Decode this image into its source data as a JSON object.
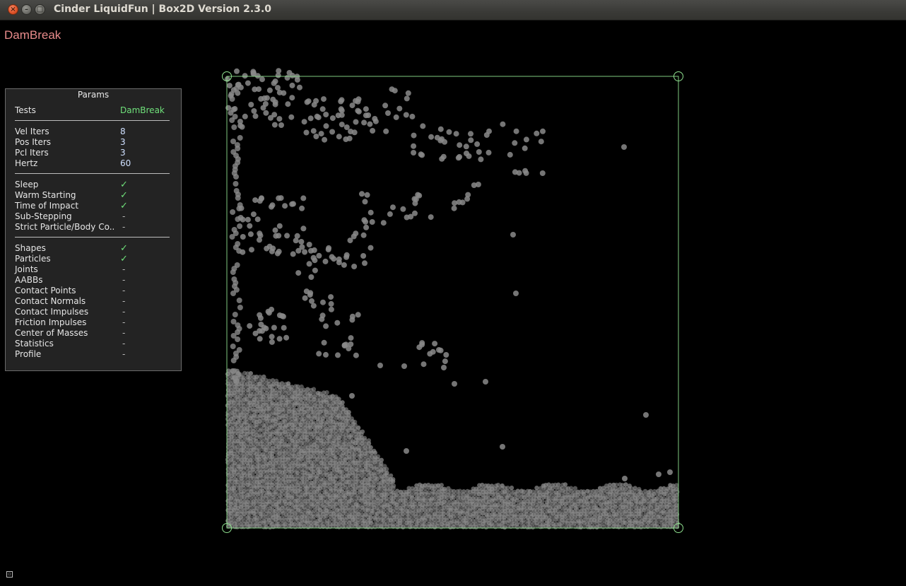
{
  "window": {
    "title": "Cinder LiquidFun | Box2D Version 2.3.0",
    "close_glyph": "×",
    "minimize_glyph": "–",
    "maximize_glyph": "□"
  },
  "scene": {
    "title": "DamBreak"
  },
  "params": {
    "title": "Params",
    "tests": {
      "label": "Tests",
      "value": "DamBreak"
    },
    "iterations": [
      {
        "label": "Vel Iters",
        "value": "8"
      },
      {
        "label": "Pos Iters",
        "value": "3"
      },
      {
        "label": "Pcl Iters",
        "value": "3"
      },
      {
        "label": "Hertz",
        "value": "60"
      }
    ],
    "toggles": [
      {
        "label": "Sleep",
        "state": "✓"
      },
      {
        "label": "Warm Starting",
        "state": "✓"
      },
      {
        "label": "Time of Impact",
        "state": "✓"
      },
      {
        "label": "Sub-Stepping",
        "state": "-"
      },
      {
        "label": "Strict Particle/Body Co..",
        "state": "-"
      }
    ],
    "draw": [
      {
        "label": "Shapes",
        "state": "✓"
      },
      {
        "label": "Particles",
        "state": "✓"
      },
      {
        "label": "Joints",
        "state": "-"
      },
      {
        "label": "AABBs",
        "state": "-"
      },
      {
        "label": "Contact Points",
        "state": "-"
      },
      {
        "label": "Contact Normals",
        "state": "-"
      },
      {
        "label": "Contact Impulses",
        "state": "-"
      },
      {
        "label": "Friction Impulses",
        "state": "-"
      },
      {
        "label": "Center of Masses",
        "state": "-"
      },
      {
        "label": "Statistics",
        "state": "-"
      },
      {
        "label": "Profile",
        "state": "-"
      }
    ]
  },
  "colors": {
    "background": "#000000",
    "container_outline": "#8fe08f",
    "particle": "#8a8a8a",
    "scene_title": "#e88b8b",
    "value_green": "#6fe07a"
  },
  "icons": {
    "corner": "settings-icon"
  }
}
